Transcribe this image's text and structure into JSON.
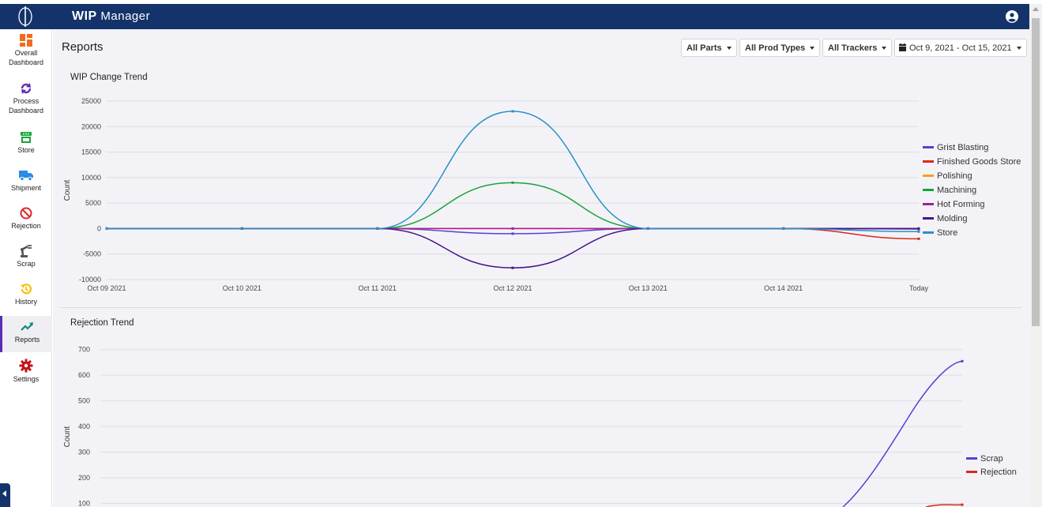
{
  "app": {
    "title_bold": "WIP",
    "title_rest": " Manager"
  },
  "sidebar": {
    "items": [
      {
        "label_1": "Overall",
        "label_2": "Dashboard",
        "icon": "dashboard-icon",
        "color": "#f26b1d"
      },
      {
        "label_1": "Process",
        "label_2": "Dashboard",
        "icon": "sync-icon",
        "color": "#5b2db3"
      },
      {
        "label_1": "Store",
        "label_2": "",
        "icon": "store-icon",
        "color": "#1aa33a"
      },
      {
        "label_1": "Shipment",
        "label_2": "",
        "icon": "truck-icon",
        "color": "#2a8ce8"
      },
      {
        "label_1": "Rejection",
        "label_2": "",
        "icon": "ban-icon",
        "color": "#e0252b"
      },
      {
        "label_1": "Scrap",
        "label_2": "",
        "icon": "robot-arm-icon",
        "color": "#555555"
      },
      {
        "label_1": "History",
        "label_2": "",
        "icon": "history-icon",
        "color": "#f5c300"
      },
      {
        "label_1": "Reports",
        "label_2": "",
        "icon": "trend-icon",
        "color": "#138a7a"
      },
      {
        "label_1": "Settings",
        "label_2": "",
        "icon": "gear-icon",
        "color": "#c4151c"
      }
    ],
    "active": "Reports"
  },
  "page": {
    "title": "Reports",
    "filters": {
      "parts": "All Parts",
      "prod_types": "All Prod Types",
      "trackers": "All Trackers",
      "date_range": "Oct 9, 2021 - Oct 15, 2021"
    }
  },
  "chart_data": [
    {
      "type": "line",
      "title": "WIP Change Trend",
      "ylabel": "Count",
      "xlabel": "",
      "categories": [
        "Oct 09 2021",
        "Oct 10 2021",
        "Oct 11 2021",
        "Oct 12 2021",
        "Oct 13 2021",
        "Oct 14 2021",
        "Today"
      ],
      "ylim": [
        -10000,
        25000
      ],
      "yticks": [
        25000,
        20000,
        15000,
        10000,
        5000,
        0,
        -5000,
        -10000
      ],
      "legend_position": "right",
      "series": [
        {
          "name": "Grist Blasting",
          "color": "#5b3fcf",
          "values": [
            0,
            0,
            0,
            -1000,
            0,
            0,
            -100
          ]
        },
        {
          "name": "Finished Goods Store",
          "color": "#d42a1c",
          "values": [
            0,
            0,
            0,
            0,
            0,
            0,
            -2000
          ]
        },
        {
          "name": "Polishing",
          "color": "#f5a31a",
          "values": [
            0,
            0,
            0,
            0,
            0,
            0,
            0
          ]
        },
        {
          "name": "Machining",
          "color": "#1aa33a",
          "values": [
            0,
            0,
            0,
            9000,
            0,
            0,
            0
          ]
        },
        {
          "name": "Hot Forming",
          "color": "#a01fa0",
          "values": [
            0,
            0,
            0,
            0,
            0,
            0,
            0
          ]
        },
        {
          "name": "Molding",
          "color": "#4a148c",
          "values": [
            0,
            0,
            0,
            -7700,
            0,
            0,
            0
          ]
        },
        {
          "name": "Store",
          "color": "#2b90c8",
          "values": [
            0,
            0,
            0,
            23000,
            0,
            0,
            -600
          ]
        }
      ]
    },
    {
      "type": "line",
      "title": "Rejection Trend",
      "ylabel": "Count",
      "xlabel": "",
      "yticks": [
        700,
        600,
        500,
        400,
        300,
        200,
        100
      ],
      "ylim": [
        100,
        700
      ],
      "legend_position": "right",
      "series": [
        {
          "name": "Scrap",
          "color": "#5b3fcf",
          "last_value": 655
        },
        {
          "name": "Rejection",
          "color": "#d42a1c",
          "last_value": 95
        }
      ]
    }
  ]
}
